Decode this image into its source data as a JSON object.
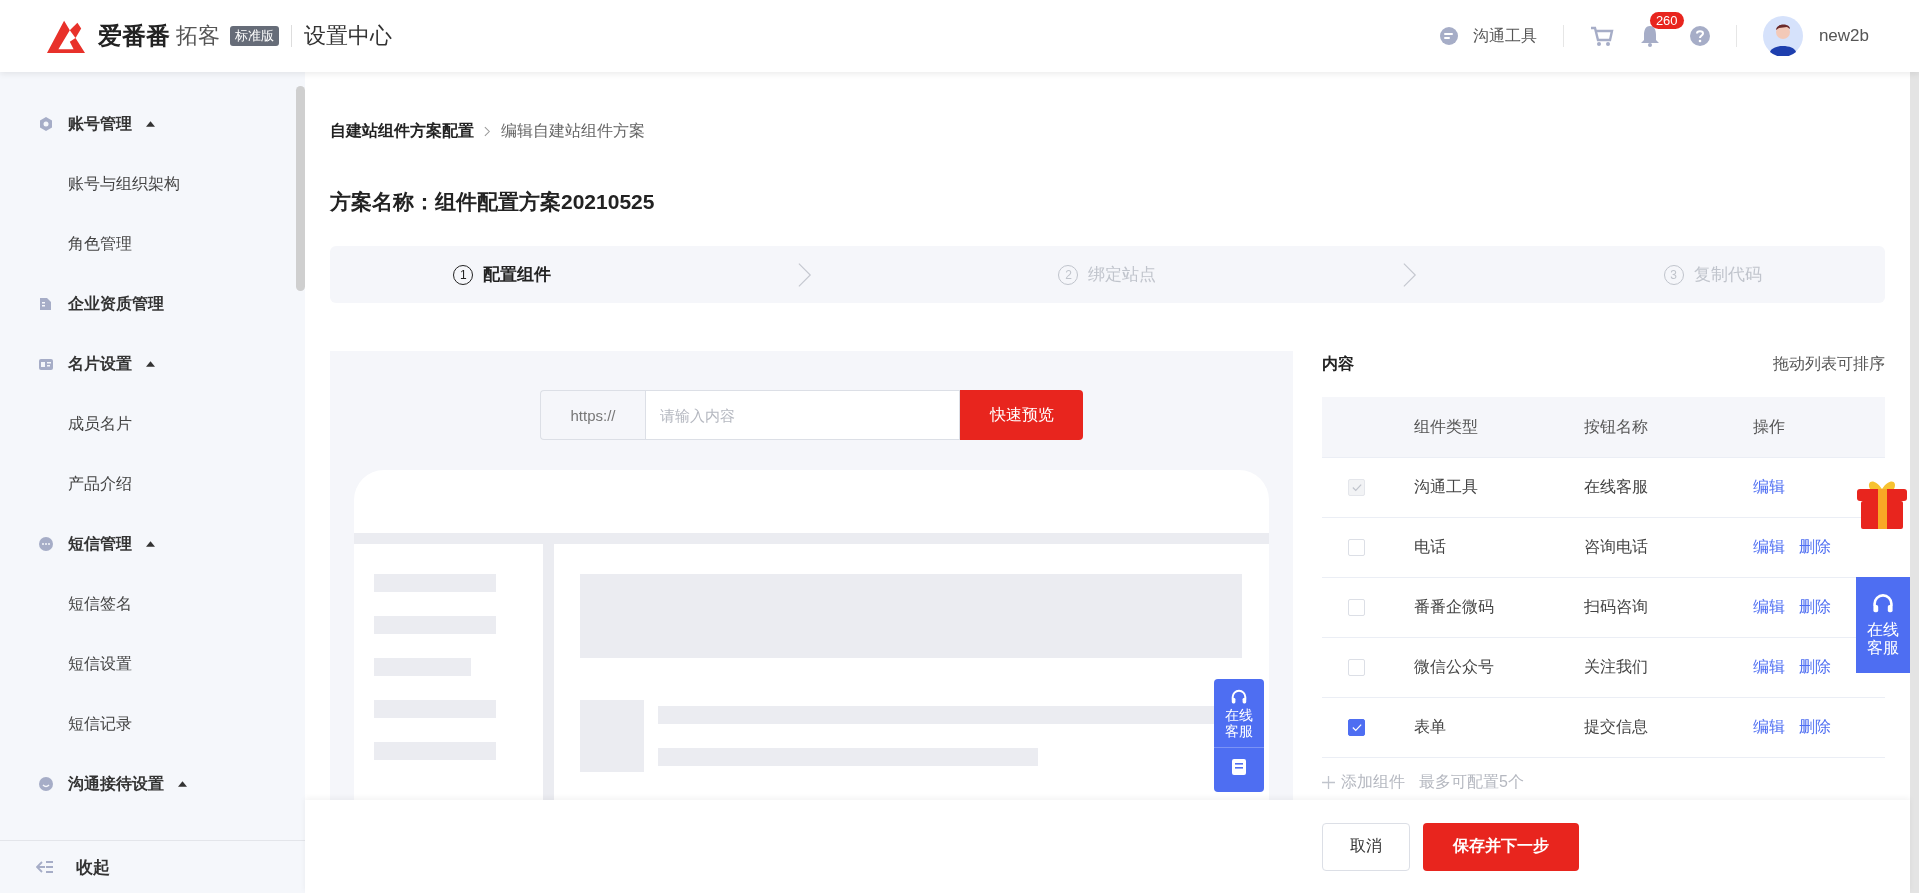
{
  "header": {
    "brand": "爱番番",
    "product": "拓客",
    "edition": "标准版",
    "section": "设置中心",
    "tool": "沟通工具",
    "notifications": "260",
    "user": "new2b"
  },
  "sidebar": {
    "groups": [
      {
        "label": "账号管理",
        "expanded": true,
        "children": [
          {
            "label": "账号与组织架构"
          },
          {
            "label": "角色管理"
          }
        ]
      },
      {
        "label": "企业资质管理"
      },
      {
        "label": "名片设置",
        "expanded": true,
        "children": [
          {
            "label": "成员名片"
          },
          {
            "label": "产品介绍"
          }
        ]
      },
      {
        "label": "短信管理",
        "expanded": true,
        "children": [
          {
            "label": "短信签名"
          },
          {
            "label": "短信设置"
          },
          {
            "label": "短信记录"
          }
        ]
      },
      {
        "label": "沟通接待设置",
        "expanded": true
      }
    ],
    "collapse": "收起"
  },
  "breadcrumb": [
    "自建站组件方案配置",
    "编辑自建站组件方案"
  ],
  "title": "方案名称：组件配置方案20210525",
  "steps": [
    {
      "number": "1",
      "label": "配置组件",
      "selected": true
    },
    {
      "number": "2",
      "label": "绑定站点",
      "selected": false
    },
    {
      "number": "3",
      "label": "复制代码",
      "selected": false
    }
  ],
  "preview": {
    "prefix": "https://",
    "placeholder": "请输入内容",
    "button": "快速预览",
    "widget": "在线客服"
  },
  "content": {
    "title": "内容",
    "hint": "拖动列表可排序",
    "columns": [
      "组件类型",
      "按钮名称",
      "操作"
    ],
    "rows": [
      {
        "checked": true,
        "disabled": true,
        "type": "沟通工具",
        "name": "在线客服",
        "actions": [
          "编辑"
        ]
      },
      {
        "checked": false,
        "disabled": false,
        "type": "电话",
        "name": "咨询电话",
        "actions": [
          "编辑",
          "删除"
        ]
      },
      {
        "checked": false,
        "disabled": false,
        "type": "番番企微码",
        "name": "扫码咨询",
        "actions": [
          "编辑",
          "删除"
        ]
      },
      {
        "checked": false,
        "disabled": false,
        "type": "微信公众号",
        "name": "关注我们",
        "actions": [
          "编辑",
          "删除"
        ]
      },
      {
        "checked": true,
        "disabled": false,
        "type": "表单",
        "name": "提交信息",
        "actions": [
          "编辑",
          "删除"
        ]
      }
    ],
    "add": "添加组件",
    "limit": "最多可配置5个"
  },
  "footer": {
    "cancel": "取消",
    "submit": "保存并下一步"
  },
  "float_service": "在线客服"
}
